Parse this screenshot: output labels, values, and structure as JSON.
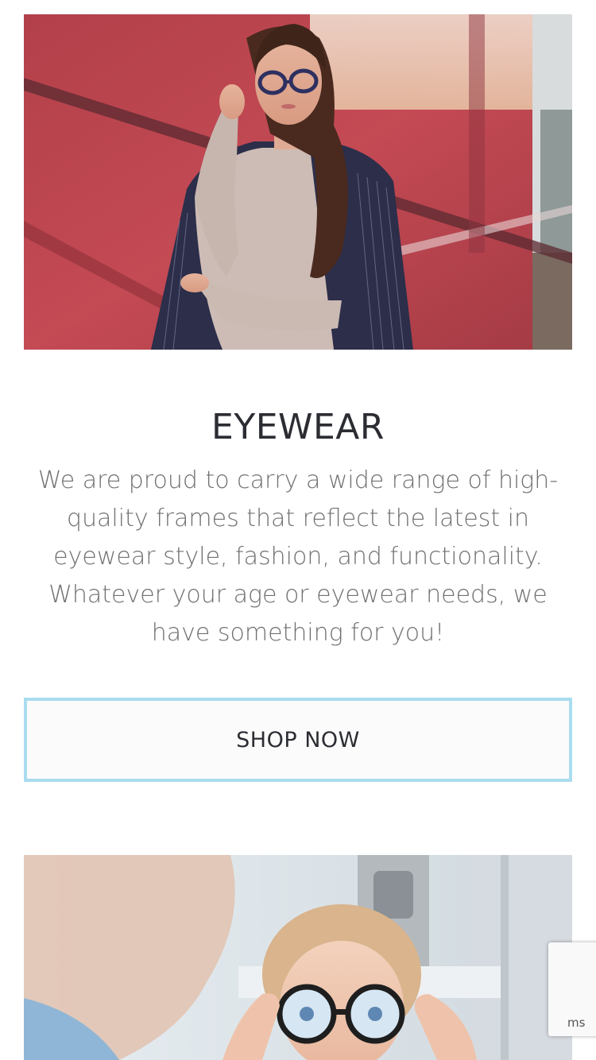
{
  "hero_top": {
    "alt_icon": "photo-woman-glasses"
  },
  "section": {
    "title": "EYEWEAR",
    "body": "We are proud to carry a wide range of high-quality frames that reflect the latest in eyewear style, fashion, and functionality. Whatever your age or eyewear needs, we have something for you!"
  },
  "cta": {
    "label": "SHOP NOW"
  },
  "hero_bottom": {
    "alt_icon": "photo-child-glasses-fitting"
  },
  "recaptcha": {
    "text": "ms"
  },
  "colors": {
    "title": "#2b2d33",
    "body": "#707070",
    "cta_border": "#a9dcef",
    "cta_bg": "#fbfbfb"
  }
}
